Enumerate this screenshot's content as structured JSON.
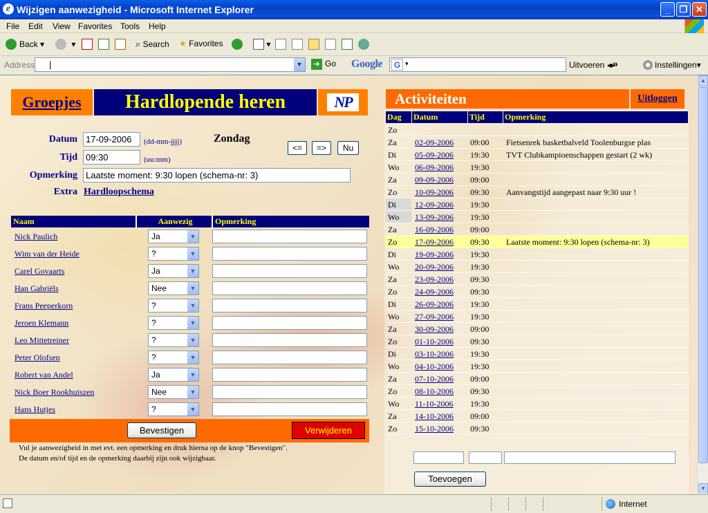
{
  "window": {
    "title": "Wijzigen aanwezigheid - Microsoft Internet Explorer"
  },
  "menu": [
    "File",
    "Edit",
    "View",
    "Favorites",
    "Tools",
    "Help"
  ],
  "toolbar": {
    "back": "Back",
    "search": "Search",
    "favorites": "Favorites"
  },
  "address": {
    "label": "Address",
    "value": "",
    "go": "Go",
    "google": "Google",
    "uitvoeren": "Uitvoeren",
    "more": "»",
    "instellingen": "Instellingen"
  },
  "page": {
    "groepjes": "Groepjes",
    "team": "Hardlopende heren",
    "logo": "NP",
    "form": {
      "datum_label": "Datum",
      "datum_value": "17-09-2006",
      "datum_hint": "(dd-mm-jjjj)",
      "dayname": "Zondag",
      "tijd_label": "Tijd",
      "tijd_value": "09:30",
      "tijd_hint": "(uu:mm)",
      "opmerking_label": "Opmerking",
      "opmerking_value": "Laatste moment: 9:30 lopen (schema-nr: 3)",
      "extra_label": "Extra",
      "extra_link": "Hardloopschema",
      "prev": "<=",
      "next": "=>",
      "now": "Nu"
    },
    "members_header": {
      "naam": "Naam",
      "aanwezig": "Aanwezig",
      "opmerking": "Opmerking"
    },
    "members": [
      {
        "name": "Nick Paulich",
        "status": "Ja"
      },
      {
        "name": "Wim van der Heide",
        "status": "?"
      },
      {
        "name": "Carel Govaarts",
        "status": "Ja"
      },
      {
        "name": "Han Gabriëls",
        "status": "Nee"
      },
      {
        "name": "Frans Peeperkorn",
        "status": "?"
      },
      {
        "name": "Jeroen Klemann",
        "status": "?"
      },
      {
        "name": "Leo Mittetreiner",
        "status": "?"
      },
      {
        "name": "Peter Olofsen",
        "status": "?"
      },
      {
        "name": "Robert van Andel",
        "status": "Ja"
      },
      {
        "name": "Nick Boer Rookhuiszen",
        "status": "Nee"
      },
      {
        "name": "Hans Hutjes",
        "status": "?"
      }
    ],
    "confirm": "Bevestigen",
    "delete": "Verwijderen",
    "note1": "Vul je aanwezigheid in met evt. een opmerking en druk hierna op de knop \"Bevestigen\".",
    "note2": "De datum en/of tijd en de opmerking daarbij zijn ook wijzigbaar.",
    "activities_title": "Activiteiten",
    "logout": "Uitloggen",
    "act_header": {
      "dag": "Dag",
      "datum": "Datum",
      "tijd": "Tijd",
      "opmerking": "Opmerking"
    },
    "activities": [
      {
        "dag": "Zo",
        "datum": "",
        "tijd": "",
        "opm": ""
      },
      {
        "dag": "Za",
        "datum": "02-09-2006",
        "tijd": "09:00",
        "opm": "Fietsenrek basketbalveld Toolenburgse plas"
      },
      {
        "dag": "Di",
        "datum": "05-09-2006",
        "tijd": "19:30",
        "opm": "TVT Clubkampioenschappen gestart (2 wk)"
      },
      {
        "dag": "Wo",
        "datum": "06-09-2006",
        "tijd": "19:30",
        "opm": ""
      },
      {
        "dag": "Za",
        "datum": "09-09-2006",
        "tijd": "09:00",
        "opm": ""
      },
      {
        "dag": "Zo",
        "datum": "10-09-2006",
        "tijd": "09:30",
        "opm": "Aanvangstijd aangepast naar 9:30 uur !"
      },
      {
        "dag": "Di",
        "datum": "12-09-2006",
        "tijd": "19:30",
        "opm": ""
      },
      {
        "dag": "Wo",
        "datum": "13-09-2006",
        "tijd": "19:30",
        "opm": ""
      },
      {
        "dag": "Za",
        "datum": "16-09-2006",
        "tijd": "09:00",
        "opm": ""
      },
      {
        "dag": "Zo",
        "datum": "17-09-2006",
        "tijd": "09:30",
        "opm": "Laatste moment: 9:30 lopen (schema-nr: 3)"
      },
      {
        "dag": "Di",
        "datum": "19-09-2006",
        "tijd": "19:30",
        "opm": ""
      },
      {
        "dag": "Wo",
        "datum": "20-09-2006",
        "tijd": "19:30",
        "opm": ""
      },
      {
        "dag": "Za",
        "datum": "23-09-2006",
        "tijd": "09:30",
        "opm": ""
      },
      {
        "dag": "Zo",
        "datum": "24-09-2006",
        "tijd": "09:30",
        "opm": ""
      },
      {
        "dag": "Di",
        "datum": "26-09-2006",
        "tijd": "19:30",
        "opm": ""
      },
      {
        "dag": "Wo",
        "datum": "27-09-2006",
        "tijd": "19:30",
        "opm": ""
      },
      {
        "dag": "Za",
        "datum": "30-09-2006",
        "tijd": "09:00",
        "opm": ""
      },
      {
        "dag": "Zo",
        "datum": "01-10-2006",
        "tijd": "09:30",
        "opm": ""
      },
      {
        "dag": "Di",
        "datum": "03-10-2006",
        "tijd": "19:30",
        "opm": ""
      },
      {
        "dag": "Wo",
        "datum": "04-10-2006",
        "tijd": "19:30",
        "opm": ""
      },
      {
        "dag": "Za",
        "datum": "07-10-2006",
        "tijd": "09:00",
        "opm": ""
      },
      {
        "dag": "Zo",
        "datum": "08-10-2006",
        "tijd": "09:30",
        "opm": ""
      },
      {
        "dag": "Wo",
        "datum": "11-10-2006",
        "tijd": "19:30",
        "opm": ""
      },
      {
        "dag": "Za",
        "datum": "14-10-2006",
        "tijd": "09:00",
        "opm": ""
      },
      {
        "dag": "Zo",
        "datum": "15-10-2006",
        "tijd": "09:30",
        "opm": ""
      }
    ],
    "add": "Toevoegen"
  },
  "status": {
    "zone": "Internet"
  }
}
